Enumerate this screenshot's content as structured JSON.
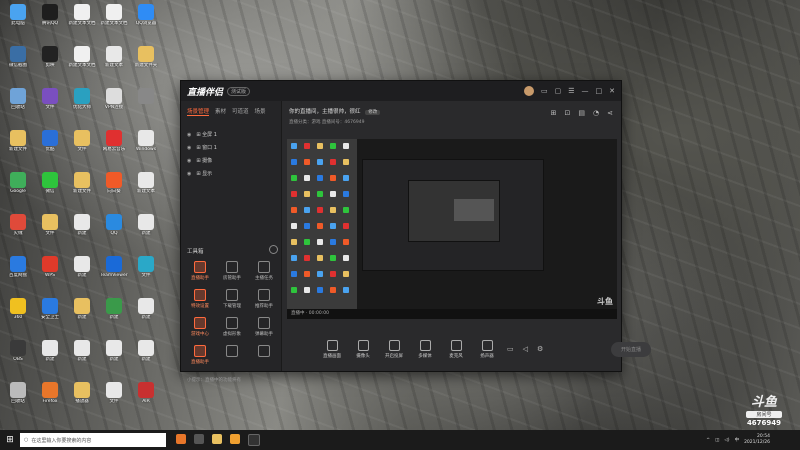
{
  "desktop": {
    "icons": [
      {
        "label": "此电脑",
        "color": "#4aa3f0"
      },
      {
        "label": "腾讯QQ",
        "color": "#1e1e1e"
      },
      {
        "label": "新建文本文档",
        "color": "#f0f0f0"
      },
      {
        "label": "新建文本文档",
        "color": "#f0f0f0"
      },
      {
        "label": "QQ浏览器",
        "color": "#2f8cf5"
      },
      {
        "label": "微信截图",
        "color": "#3a6ea5"
      },
      {
        "label": "剪映",
        "color": "#222"
      },
      {
        "label": "新建文本文档",
        "color": "#f0f0f0"
      },
      {
        "label": "新建文本",
        "color": "#e8e8e8"
      },
      {
        "label": "新建文件夹",
        "color": "#e8c060"
      },
      {
        "label": "回收站",
        "color": "#6fa3d8"
      },
      {
        "label": "文件",
        "color": "#7a4fc0"
      },
      {
        "label": "优化大师",
        "color": "#2aa0c0"
      },
      {
        "label": "VPN连接",
        "color": "#ddd"
      },
      {
        "label": "",
        "color": "#888"
      },
      {
        "label": "新建文件",
        "color": "#e8c060"
      },
      {
        "label": "优酷",
        "color": "#2a6fd8"
      },
      {
        "label": "文件",
        "color": "#e8c060"
      },
      {
        "label": "网易云音乐",
        "color": "#e03030"
      },
      {
        "label": "Windows",
        "color": "#e8e8e8"
      },
      {
        "label": "Google",
        "color": "#3fae5a"
      },
      {
        "label": "微信",
        "color": "#2ec43c"
      },
      {
        "label": "新建文件",
        "color": "#e8c060"
      },
      {
        "label": "向日葵",
        "color": "#f05a28"
      },
      {
        "label": "新建文本",
        "color": "#e8e8e8"
      },
      {
        "label": "火绒",
        "color": "#e04a3a"
      },
      {
        "label": "文件",
        "color": "#e8c060"
      },
      {
        "label": "新建",
        "color": "#e8e8e8"
      },
      {
        "label": "QQ",
        "color": "#2a8ae0"
      },
      {
        "label": "新建",
        "color": "#e8e8e8"
      },
      {
        "label": "百度网盘",
        "color": "#2a7ae0"
      },
      {
        "label": "WPS",
        "color": "#e03a2a"
      },
      {
        "label": "新建",
        "color": "#e8e8e8"
      },
      {
        "label": "TeamViewer",
        "color": "#1a6ad8"
      },
      {
        "label": "文件",
        "color": "#2aa8c8"
      },
      {
        "label": "360",
        "color": "#f0c020"
      },
      {
        "label": "安全卫士",
        "color": "#2a7ae0"
      },
      {
        "label": "新建",
        "color": "#e8c060"
      },
      {
        "label": "新建",
        "color": "#3a9a4a"
      },
      {
        "label": "新建",
        "color": "#e8e8e8"
      },
      {
        "label": "OBS",
        "color": "#3a3a3a"
      },
      {
        "label": "新建",
        "color": "#e8e8e8"
      },
      {
        "label": "新建",
        "color": "#e8e8e8"
      },
      {
        "label": "新建",
        "color": "#e8e8e8"
      },
      {
        "label": "新建",
        "color": "#e8e8e8"
      },
      {
        "label": "回收站",
        "color": "#bbb"
      },
      {
        "label": "Firefox",
        "color": "#e8762a"
      },
      {
        "label": "播放器",
        "color": "#e8c060"
      },
      {
        "label": "文件",
        "color": "#e8e8e8"
      },
      {
        "label": "AIR",
        "color": "#c83030"
      }
    ]
  },
  "app": {
    "brand": "直播伴侣",
    "brand_badge": "测试版",
    "tabs": [
      "场景管理",
      "素材",
      "可道道",
      "场景"
    ],
    "scenes": [
      "全屏 1",
      "窗口 1",
      "摄像",
      "显示"
    ],
    "tools_title": "工具箱",
    "tools": [
      {
        "label": "直播助手",
        "orange": true
      },
      {
        "label": "房管助手",
        "orange": false
      },
      {
        "label": "主播任务",
        "orange": false
      },
      {
        "label": "特效设置",
        "orange": true
      },
      {
        "label": "下载管理",
        "orange": false
      },
      {
        "label": "推荐助手",
        "orange": false
      },
      {
        "label": "游戏中心",
        "orange": true
      },
      {
        "label": "虚拟形象",
        "orange": false
      },
      {
        "label": "弹幕助手",
        "orange": false
      },
      {
        "label": "直播助手",
        "orange": true
      },
      {
        "label": "",
        "orange": false
      },
      {
        "label": "",
        "orange": false
      }
    ],
    "footnote": "小提示：直播中的功能将有",
    "stream_title": "你的直播间，主播很帅，很红",
    "stream_tag": "修改",
    "stream_meta": "直播分类：游戏  直播间号：4676949",
    "preview_bottom": "直播中 · 00:00:00",
    "controls": [
      "直播画面",
      "摄像头",
      "开启投屏",
      "多媒体",
      "麦克风",
      "扬声器"
    ],
    "go_live": "开始直播",
    "watermark": "斗鱼"
  },
  "taskbar": {
    "search_placeholder": "在这里输入你要搜索的内容",
    "time": "20:54",
    "date": "2021/12/26"
  },
  "overlay": {
    "logo": "斗鱼",
    "room_label": "房间号",
    "room_number": "4676949"
  },
  "icons": [
    "windows-icon",
    "search-icon",
    "eye-icon",
    "gear-icon",
    "microphone-icon",
    "speaker-icon",
    "camera-icon",
    "settings-icon",
    "share-icon",
    "bell-icon"
  ]
}
